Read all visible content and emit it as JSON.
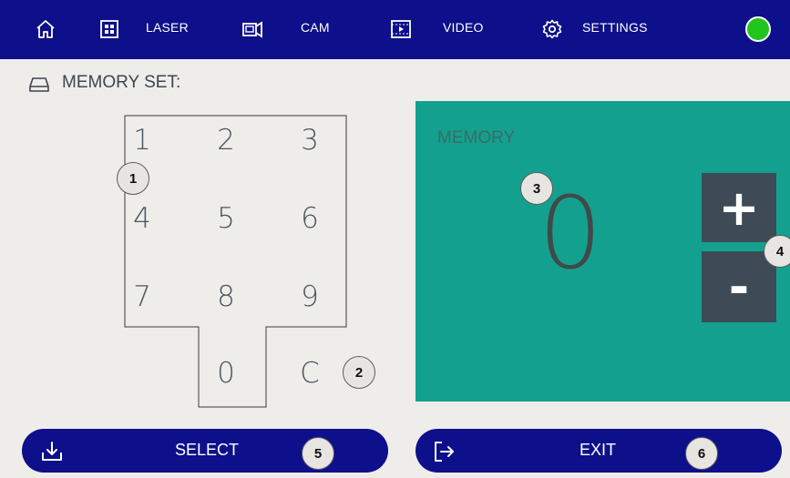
{
  "nav": {
    "items": [
      {
        "label": "",
        "icon": "home-icon"
      },
      {
        "label": "LASER",
        "icon": "laser-grid-icon"
      },
      {
        "label": "CAM",
        "icon": "camera-icon"
      },
      {
        "label": "VIDEO",
        "icon": "video-icon"
      },
      {
        "label": "SETTINGS",
        "icon": "gear-icon"
      }
    ],
    "status_color": "#22c41e"
  },
  "section": {
    "title": "MEMORY SET:",
    "icon": "drive-icon"
  },
  "keypad": {
    "keys": [
      "1",
      "2",
      "3",
      "4",
      "5",
      "6",
      "7",
      "8",
      "9",
      "0",
      "C"
    ]
  },
  "memory": {
    "label": "MEMORY",
    "value": "0",
    "plus_label": "+",
    "minus_label": "-"
  },
  "actions": {
    "select_label": "SELECT",
    "exit_label": "EXIT"
  },
  "callouts": [
    "1",
    "2",
    "3",
    "4",
    "5",
    "6"
  ],
  "colors": {
    "nav_bg": "#0e0f8a",
    "panel_bg": "#14a08f",
    "button_dark": "#3e4a55",
    "page_bg": "#efedea"
  }
}
